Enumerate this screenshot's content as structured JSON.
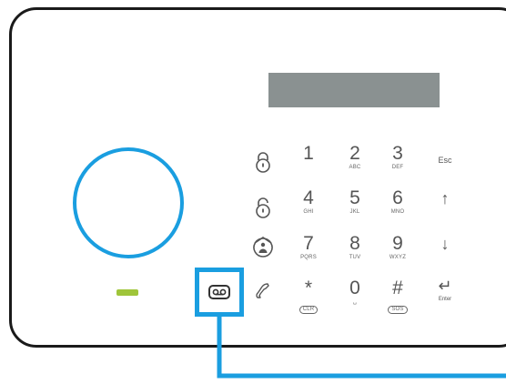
{
  "keypad": {
    "keys": [
      {
        "digit": "1",
        "sub": ""
      },
      {
        "digit": "2",
        "sub": "ABC"
      },
      {
        "digit": "3",
        "sub": "DEF"
      },
      {
        "digit": "4",
        "sub": "GHI"
      },
      {
        "digit": "5",
        "sub": "JKL"
      },
      {
        "digit": "6",
        "sub": "MNO"
      },
      {
        "digit": "7",
        "sub": "PQRS"
      },
      {
        "digit": "8",
        "sub": "TUV"
      },
      {
        "digit": "9",
        "sub": "WXYZ"
      },
      {
        "digit": "*",
        "sub": "CLR"
      },
      {
        "digit": "0",
        "sub": "␣"
      },
      {
        "digit": "#",
        "sub": "SOS"
      }
    ],
    "side": {
      "esc": "Esc",
      "up": "↑",
      "down": "↓",
      "enter_symbol": "↵",
      "enter_label": "Enter"
    }
  },
  "icons": [
    "lock-icon",
    "unlock-icon",
    "home-arm-icon",
    "phone-icon",
    "voicemail-icon"
  ],
  "colors": {
    "accent": "#1a9ee0",
    "led": "#9fc53a",
    "display": "#8a9191",
    "outline": "#1a1a1a"
  }
}
